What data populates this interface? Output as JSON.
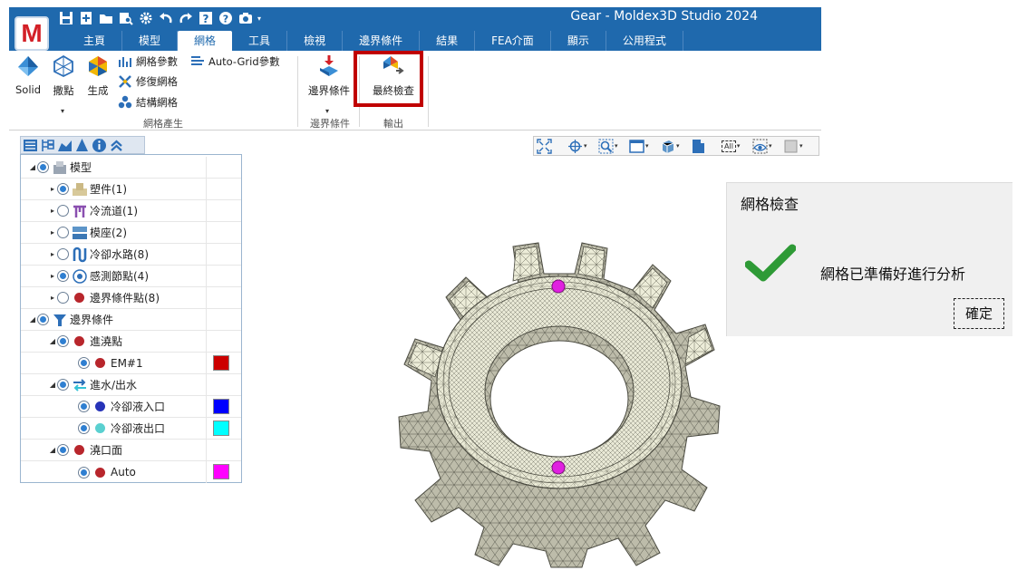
{
  "app": {
    "logo_text": "M",
    "window_title": "Gear - Moldex3D Studio 2024"
  },
  "quick_access": {
    "icons": [
      "save-icon",
      "new-icon",
      "open-icon",
      "find-icon",
      "settings-icon",
      "undo-icon",
      "redo-icon",
      "help-book-icon",
      "help-icon",
      "camera-icon"
    ]
  },
  "tabs": [
    {
      "label": "主頁",
      "active": false
    },
    {
      "label": "模型",
      "active": false
    },
    {
      "label": "網格",
      "active": true
    },
    {
      "label": "工具",
      "active": false
    },
    {
      "label": "檢視",
      "active": false
    },
    {
      "label": "邊界條件",
      "active": false
    },
    {
      "label": "結果",
      "active": false
    },
    {
      "label": "FEA介面",
      "active": false
    },
    {
      "label": "顯示",
      "active": false
    },
    {
      "label": "公用程式",
      "active": false
    }
  ],
  "ribbon": {
    "solid": "Solid",
    "seed": "撒點",
    "generate": "生成",
    "mesh_params": "網格參數",
    "repair_mesh": "修復網格",
    "structured_mesh": "結構網格",
    "autogrid_params": "Auto-Grid參數",
    "group_mesh_gen": "網格產生",
    "boundary_conditions": "邊界條件",
    "group_bc": "邊界條件",
    "final_check": "最終檢查",
    "group_output": "輸出"
  },
  "tree": {
    "rows": [
      {
        "label": "模型",
        "level": 0,
        "expand": "◢",
        "radio": "on",
        "icon": "model-icon"
      },
      {
        "label": "塑件(1)",
        "level": 1,
        "expand": "▸",
        "radio": "on",
        "icon": "part-icon"
      },
      {
        "label": "冷流道(1)",
        "level": 1,
        "expand": "▸",
        "radio": "off",
        "icon": "cold-runner-icon"
      },
      {
        "label": "模座(2)",
        "level": 1,
        "expand": "▸",
        "radio": "off",
        "icon": "mold-base-icon"
      },
      {
        "label": "冷卻水路(8)",
        "level": 1,
        "expand": "▸",
        "radio": "off",
        "icon": "cooling-channel-icon"
      },
      {
        "label": "感測節點(4)",
        "level": 1,
        "expand": "▸",
        "radio": "on",
        "icon": "sensor-node-icon"
      },
      {
        "label": "邊界條件點(8)",
        "level": 1,
        "expand": "▸",
        "radio": "off",
        "icon": "bc-point-icon"
      },
      {
        "label": "邊界條件",
        "level": 0,
        "expand": "◢",
        "radio": "on",
        "icon": "boundary-condition-icon"
      },
      {
        "label": "進澆點",
        "level": 1,
        "expand": "◢",
        "radio": "on",
        "icon": "gate-dot-icon"
      },
      {
        "label": "EM#1",
        "level": 2,
        "expand": "",
        "radio": "on",
        "icon": "gate-dot-icon",
        "swatch": "#cc0000"
      },
      {
        "label": "進水/出水",
        "level": 1,
        "expand": "◢",
        "radio": "on",
        "icon": "inlet-outlet-icon"
      },
      {
        "label": "冷卻液入口",
        "level": 2,
        "expand": "",
        "radio": "on",
        "icon": "inlet-dot-icon",
        "swatch": "#0000ff"
      },
      {
        "label": "冷卻液出口",
        "level": 2,
        "expand": "",
        "radio": "on",
        "icon": "outlet-dot-icon",
        "swatch": "#00ffff"
      },
      {
        "label": "澆口面",
        "level": 1,
        "expand": "◢",
        "radio": "on",
        "icon": "gate-surface-dot-icon"
      },
      {
        "label": "Auto",
        "level": 2,
        "expand": "",
        "radio": "on",
        "icon": "gate-dot-icon",
        "swatch": "#ff00ff"
      }
    ]
  },
  "viewbar": {
    "all_label": "All"
  },
  "dialog": {
    "title": "網格檢查",
    "message": "網格已準備好進行分析",
    "ok_label": "確定"
  },
  "colors": {
    "brand": "#1f69ad",
    "highlight": "#c00000",
    "gate_marker": "#e020e0",
    "mesh_fill": "#ececd8"
  }
}
